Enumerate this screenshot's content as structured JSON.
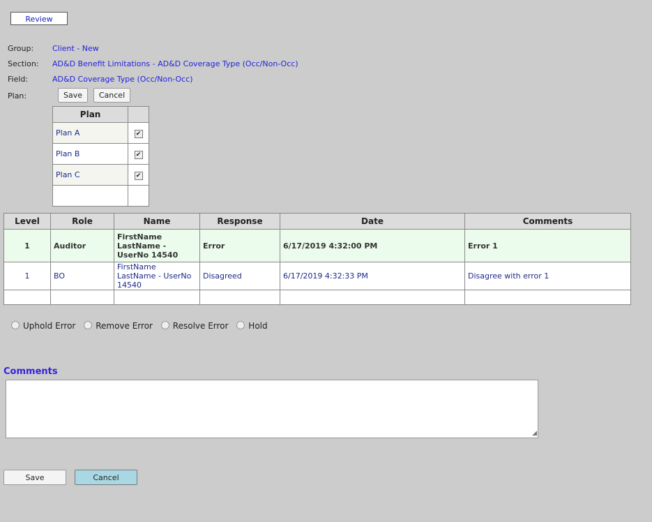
{
  "tabs": [
    {
      "label": "Review"
    }
  ],
  "info": {
    "group_label": "Group:",
    "group_value": "Client - New",
    "section_label": "Section:",
    "section_value": "AD&D Benefit Limitations - AD&D Coverage Type (Occ/Non-Occ)",
    "field_label": "Field:",
    "field_value": "AD&D Coverage Type (Occ/Non-Occ)",
    "plan_label": "Plan:"
  },
  "plan_actions": {
    "save_label": "Save",
    "cancel_label": "Cancel"
  },
  "plan_table": {
    "headers": [
      "Plan",
      ""
    ],
    "rows": [
      {
        "name": "Plan A",
        "checked": true
      },
      {
        "name": "Plan B",
        "checked": true
      },
      {
        "name": "Plan C",
        "checked": true
      }
    ]
  },
  "review_table": {
    "headers": [
      "Level",
      "Role",
      "Name",
      "Response",
      "Date",
      "Comments"
    ],
    "rows": [
      {
        "level": "1",
        "role": "Auditor",
        "name": "FirstName LastName - UserNo 14540",
        "response": "Error",
        "date": "6/17/2019 4:32:00 PM",
        "comments": "Error 1"
      },
      {
        "level": "1",
        "role": "BO",
        "name": "FirstName LastName - UserNo 14540",
        "response": "Disagreed",
        "date": "6/17/2019 4:32:33 PM",
        "comments": "Disagree with error 1"
      }
    ]
  },
  "actions_radio": [
    {
      "label": "Uphold Error",
      "selected": false
    },
    {
      "label": "Remove Error",
      "selected": false
    },
    {
      "label": "Resolve Error",
      "selected": false
    },
    {
      "label": "Hold",
      "selected": false
    }
  ],
  "comments": {
    "label": "Comments",
    "value": ""
  },
  "footer": {
    "save_label": "Save",
    "cancel_label": "Cancel"
  },
  "colors": {
    "background": "#cccccc",
    "link": "#2222dd",
    "highlight_row": "#ecfcec",
    "cancel_button": "#a9d8e4"
  },
  "icons": {
    "checkbox": "checkbox-icon",
    "radio": "radio-icon",
    "resize": "resize-grip-icon"
  }
}
